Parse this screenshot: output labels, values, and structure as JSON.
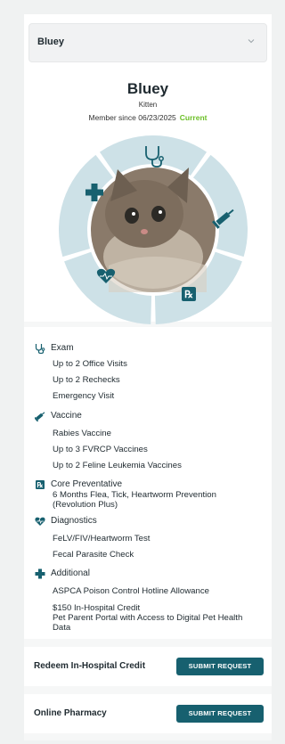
{
  "pet_selector": {
    "selected": "Bluey"
  },
  "pet": {
    "name": "Bluey",
    "type": "Kitten",
    "member_since": "Member since 06/23/2025",
    "status": "Current",
    "status_color": "#6bbf26"
  },
  "wheel_icons": [
    "stethoscope-icon",
    "syringe-icon",
    "rx-icon",
    "heart-pulse-icon",
    "cross-icon"
  ],
  "colors": {
    "accent": "#17606f",
    "wheel_segment": "#cde1e7",
    "icon": "#17606f"
  },
  "benefits": {
    "exam": {
      "title": "Exam",
      "items": [
        "Up to 2 Office Visits",
        "Up to 2 Rechecks",
        "Emergency Visit"
      ]
    },
    "vaccine": {
      "title": "Vaccine",
      "items": [
        "Rabies Vaccine",
        "Up to 3 FVRCP Vaccines",
        "Up to 2 Feline Leukemia Vaccines"
      ]
    },
    "core": {
      "title": "Core Preventative",
      "items": [
        "6 Months Flea, Tick, Heartworm Prevention (Revolution Plus)"
      ]
    },
    "diagnostics": {
      "title": "Diagnostics",
      "items": [
        "FeLV/FIV/Heartworm Test",
        "Fecal Parasite Check"
      ]
    },
    "additional": {
      "title": "Additional",
      "items": [
        "ASPCA Poison Control Hotline Allowance",
        "$150 In-Hospital Credit",
        "Pet Parent Portal with Access to Digital Pet Health Data"
      ]
    }
  },
  "actions": {
    "redeem": {
      "label": "Redeem In-Hospital Credit",
      "button": "SUBMIT REQUEST"
    },
    "pharmacy": {
      "label": "Online Pharmacy",
      "button": "SUBMIT REQUEST"
    }
  }
}
